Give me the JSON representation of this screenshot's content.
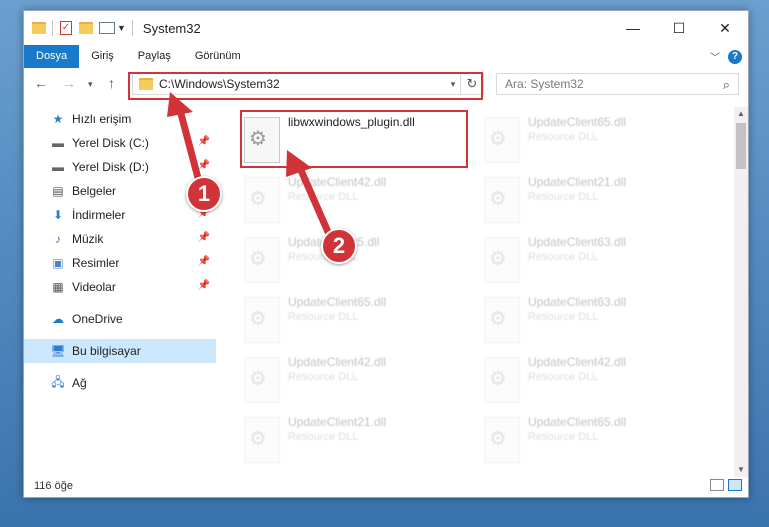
{
  "window": {
    "title": "System32",
    "controls": {
      "minimize": "—",
      "maximize": "☐",
      "close": "✕"
    }
  },
  "ribbon": {
    "tabs": [
      "Dosya",
      "Giriş",
      "Paylaş",
      "Görünüm"
    ],
    "active_tab": "Dosya",
    "help": "?"
  },
  "address": {
    "path": "C:\\Windows\\System32",
    "search_placeholder": "Ara: System32"
  },
  "nav": {
    "items": [
      {
        "label": "Hızlı erişim",
        "icon": "star-icon",
        "pinned": false
      },
      {
        "label": "Yerel Disk (C:)",
        "icon": "drive-icon",
        "pinned": true
      },
      {
        "label": "Yerel Disk (D:)",
        "icon": "drive-icon",
        "pinned": true
      },
      {
        "label": "Belgeler",
        "icon": "document-icon",
        "pinned": true
      },
      {
        "label": "İndirmeler",
        "icon": "download-icon",
        "pinned": true
      },
      {
        "label": "Müzik",
        "icon": "music-icon",
        "pinned": true
      },
      {
        "label": "Resimler",
        "icon": "pictures-icon",
        "pinned": true
      },
      {
        "label": "Videolar",
        "icon": "video-icon",
        "pinned": true
      },
      {
        "label": "OneDrive",
        "icon": "cloud-icon",
        "pinned": false
      },
      {
        "label": "Bu bilgisayar",
        "icon": "computer-icon",
        "pinned": false
      },
      {
        "label": "Ağ",
        "icon": "network-icon",
        "pinned": false
      }
    ],
    "selected": "Bu bilgisayar"
  },
  "files": [
    {
      "name": "libwxwindows_plugin.dll",
      "type": "",
      "highlighted": true
    },
    {
      "name": "UpdateClient65.dll",
      "type": "Resource DLL"
    },
    {
      "name": "UpdateClient42.dll",
      "type": "Resource DLL"
    },
    {
      "name": "UpdateClient21.dll",
      "type": "Resource DLL"
    },
    {
      "name": "UpdateClient5.dll",
      "type": "Resource DLL"
    },
    {
      "name": "UpdateClient63.dll",
      "type": "Resource DLL"
    },
    {
      "name": "UpdateClient65.dll",
      "type": "Resource DLL"
    },
    {
      "name": "UpdateClient63.dll",
      "type": "Resource DLL"
    },
    {
      "name": "UpdateClient42.dll",
      "type": "Resource DLL"
    },
    {
      "name": "UpdateClient42.dll",
      "type": "Resource DLL"
    },
    {
      "name": "UpdateClient21.dll",
      "type": "Resource DLL"
    },
    {
      "name": "UpdateClient65.dll",
      "type": "Resource DLL"
    }
  ],
  "status": {
    "count": "116 öğe"
  },
  "annotations": {
    "step1": "1",
    "step2": "2"
  },
  "colors": {
    "accent": "#1979ca",
    "highlight_red": "#d13438",
    "selected_bg": "#cce8ff"
  }
}
